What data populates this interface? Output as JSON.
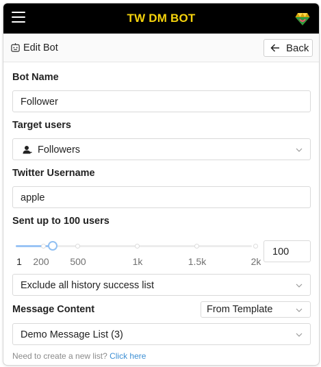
{
  "header": {
    "title": "TW DM BOT",
    "menu_icon": "hamburger-icon",
    "logo_icon": "heart-gem-logo",
    "brand_color": "#f4d20c"
  },
  "subheader": {
    "title": "Edit Bot",
    "icon": "robot-icon",
    "back_label": "Back"
  },
  "form": {
    "bot_name": {
      "label": "Bot Name",
      "value": "Follower"
    },
    "target_users": {
      "label": "Target users",
      "value": "Followers",
      "icon": "user-icon"
    },
    "twitter_username": {
      "label": "Twitter Username",
      "value": "apple"
    },
    "sent_up_to": {
      "label": "Sent up to 100 users",
      "slider": {
        "value": 100,
        "min": 1,
        "max": 2000,
        "marks": [
          "1",
          "200",
          "500",
          "1k",
          "1.5k",
          "2k"
        ]
      },
      "input_value": "100"
    },
    "history_filter": {
      "value": "Exclude all history success list"
    },
    "message_content": {
      "label": "Message Content",
      "source": "From Template",
      "list": "Demo Message List (3)"
    },
    "hint": {
      "text": "Need to create a new list?",
      "link": "Click here"
    }
  },
  "colors": {
    "accent": "#91c0f2",
    "link": "#3d8fd4"
  }
}
